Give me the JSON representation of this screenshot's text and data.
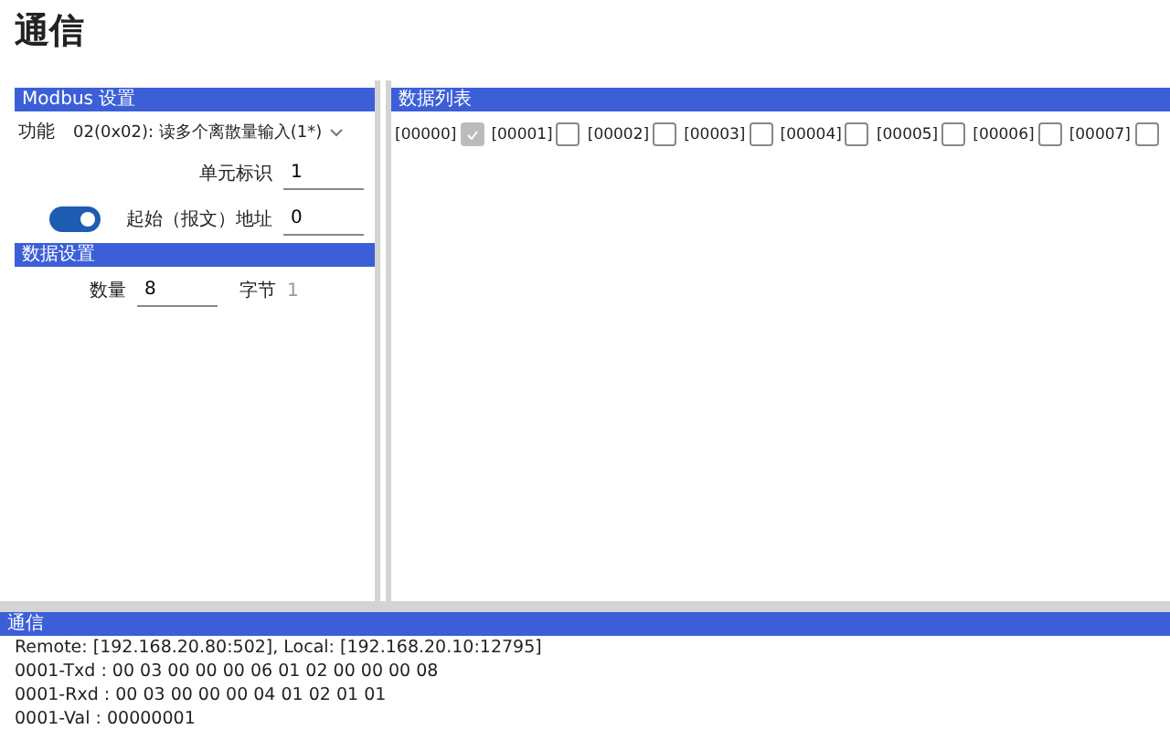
{
  "title": "通信",
  "modbus": {
    "header": "Modbus 设置",
    "function_label": "功能",
    "function_value": "02(0x02): 读多个离散量输入(1*)",
    "unit_label": "单元标识",
    "unit_value": "1",
    "start_toggle_on": true,
    "start_label": "起始（报文）地址",
    "start_value": "0"
  },
  "data_settings": {
    "header": "数据设置",
    "count_label": "数量",
    "count_value": "8",
    "bytes_label": "字节",
    "bytes_value": "1"
  },
  "data_list": {
    "header": "数据列表",
    "coils": [
      {
        "label": "[00000]",
        "checked": true
      },
      {
        "label": "[00001]",
        "checked": false
      },
      {
        "label": "[00002]",
        "checked": false
      },
      {
        "label": "[00003]",
        "checked": false
      },
      {
        "label": "[00004]",
        "checked": false
      },
      {
        "label": "[00005]",
        "checked": false
      },
      {
        "label": "[00006]",
        "checked": false
      },
      {
        "label": "[00007]",
        "checked": false
      }
    ]
  },
  "log": {
    "header": "通信",
    "lines": [
      "Remote: [192.168.20.80:502], Local: [192.168.20.10:12795]",
      "0001-Txd : 00 03 00 00 00 06 01 02 00 00 00 08",
      "0001-Rxd : 00 03 00 00 00 04 01 02 01 01",
      "0001-Val : 00000001"
    ]
  }
}
